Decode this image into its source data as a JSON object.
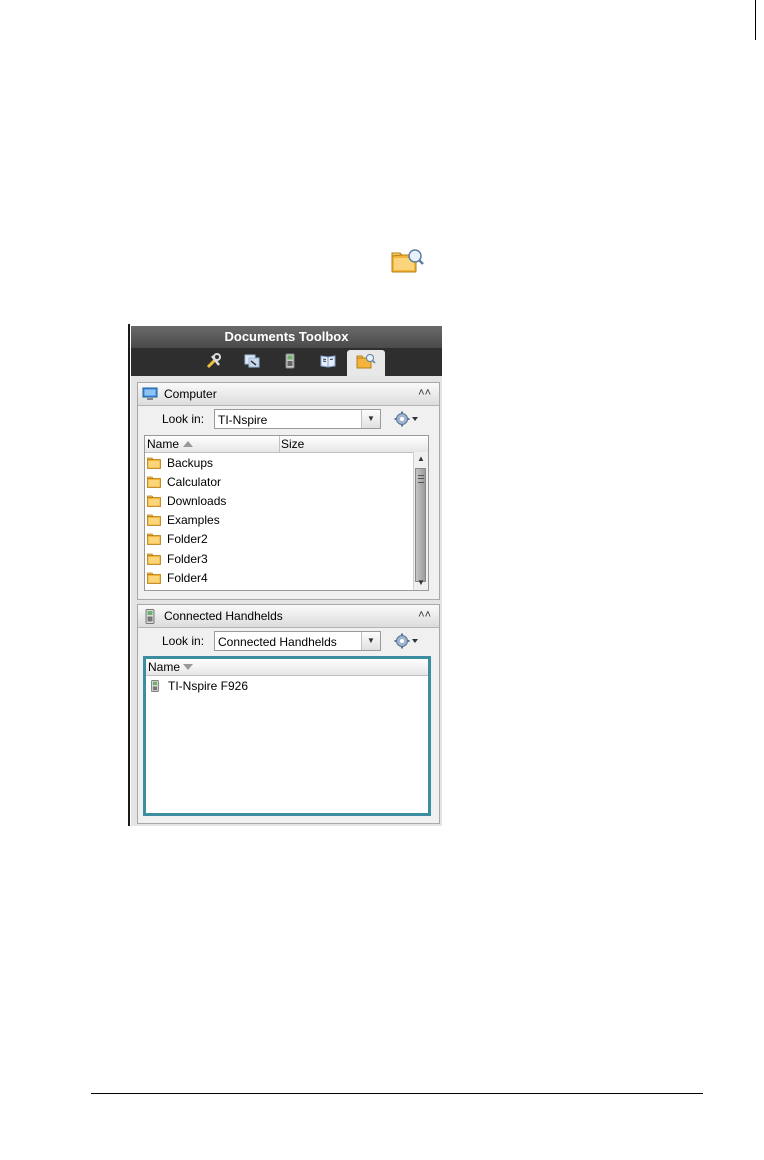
{
  "toolbox": {
    "title": "Documents Toolbox",
    "tabs": [
      {
        "icon": "tools-icon"
      },
      {
        "icon": "page-sorter-icon"
      },
      {
        "icon": "emulator-icon"
      },
      {
        "icon": "utilities-book-icon"
      },
      {
        "icon": "content-explorer-icon",
        "active": true
      }
    ]
  },
  "computer_panel": {
    "title": "Computer",
    "collapse_glyph": "˄˄",
    "lookin_label": "Look in:",
    "lookin_value": "TI-Nspire",
    "col_name": "Name",
    "col_size": "Size",
    "items": [
      "Backups",
      "Calculator",
      "Downloads",
      "Examples",
      "Folder2",
      "Folder3",
      "Folder4"
    ]
  },
  "handhelds_panel": {
    "title": "Connected Handhelds",
    "collapse_glyph": "˄˄",
    "lookin_label": "Look in:",
    "lookin_value": "Connected Handhelds",
    "col_name": "Name",
    "items": [
      "TI-Nspire F926"
    ]
  },
  "colors": {
    "highlight": "#3d8da0",
    "title_bar": "#555555",
    "tab_bar": "#2e2e2e"
  }
}
